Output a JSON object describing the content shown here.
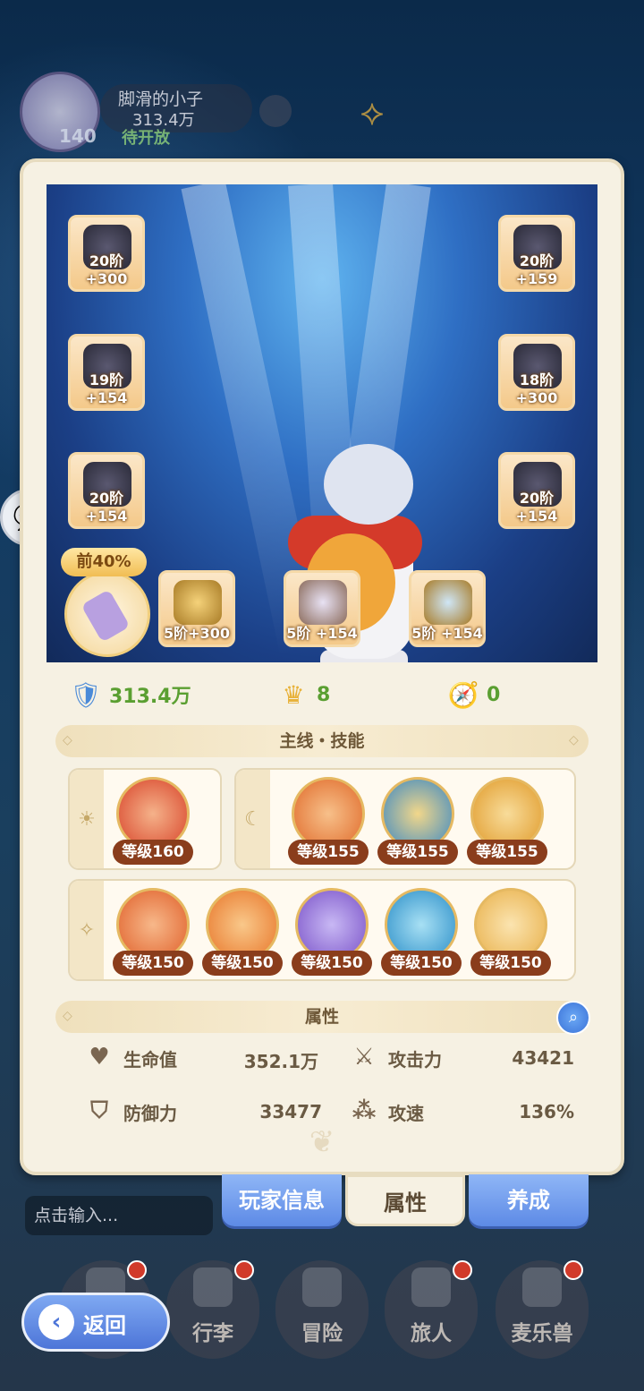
{
  "header": {
    "player_level": "140",
    "player_name": "脚滑的小子",
    "player_power": "313.4万",
    "status_text": "待开放"
  },
  "equipment": {
    "left": [
      {
        "label": "20阶+300",
        "icon": "helmet-icon"
      },
      {
        "label": "19阶+154",
        "icon": "armor-icon"
      },
      {
        "label": "20阶+154",
        "icon": "leg-armor-icon"
      }
    ],
    "right": [
      {
        "label": "20阶+159",
        "icon": "mask-helmet-icon"
      },
      {
        "label": "18阶+300",
        "icon": "gauntlet-icon"
      },
      {
        "label": "20阶+154",
        "icon": "boots-icon"
      }
    ],
    "accessories": [
      {
        "label": "5阶+300",
        "icon": "ring-icon"
      },
      {
        "label": "5阶 +154",
        "icon": "necklace-icon"
      },
      {
        "label": "5阶 +154",
        "icon": "amulet-icon"
      }
    ],
    "charm_tag": "前40%"
  },
  "stats": {
    "power": "313.4万",
    "crown": "8",
    "pet": "0"
  },
  "skills_section": {
    "title": "主线・技能",
    "group_sun": [
      {
        "level": "等级160",
        "color": "#d8442a"
      }
    ],
    "group_moon": [
      {
        "level": "等级155",
        "color": "#e06a2a"
      },
      {
        "level": "等级155",
        "color": "#3a88c4"
      },
      {
        "level": "等级155",
        "color": "#e09a2a"
      }
    ],
    "group_star": [
      {
        "level": "等级150",
        "color": "#e0602a"
      },
      {
        "level": "等级150",
        "color": "#e8762a"
      },
      {
        "level": "等级150",
        "color": "#7a52c8"
      },
      {
        "level": "等级150",
        "color": "#2a8ec8"
      },
      {
        "level": "等级150",
        "color": "#e8b04a"
      }
    ]
  },
  "attributes_section": {
    "title": "属性",
    "hp_label": "生命值",
    "hp_value": "352.1万",
    "atk_label": "攻击力",
    "atk_value": "43421",
    "def_label": "防御力",
    "def_value": "33477",
    "spd_label": "攻速",
    "spd_value": "136%"
  },
  "tabs": {
    "player_info": "玩家信息",
    "attributes": "属性",
    "cultivate": "养成"
  },
  "chat": {
    "placeholder": "点击输入..."
  },
  "nav": {
    "bag": "行李",
    "adventure": "冒险",
    "traveler": "旅人",
    "pet": "麦乐兽"
  },
  "back_label": "返回"
}
